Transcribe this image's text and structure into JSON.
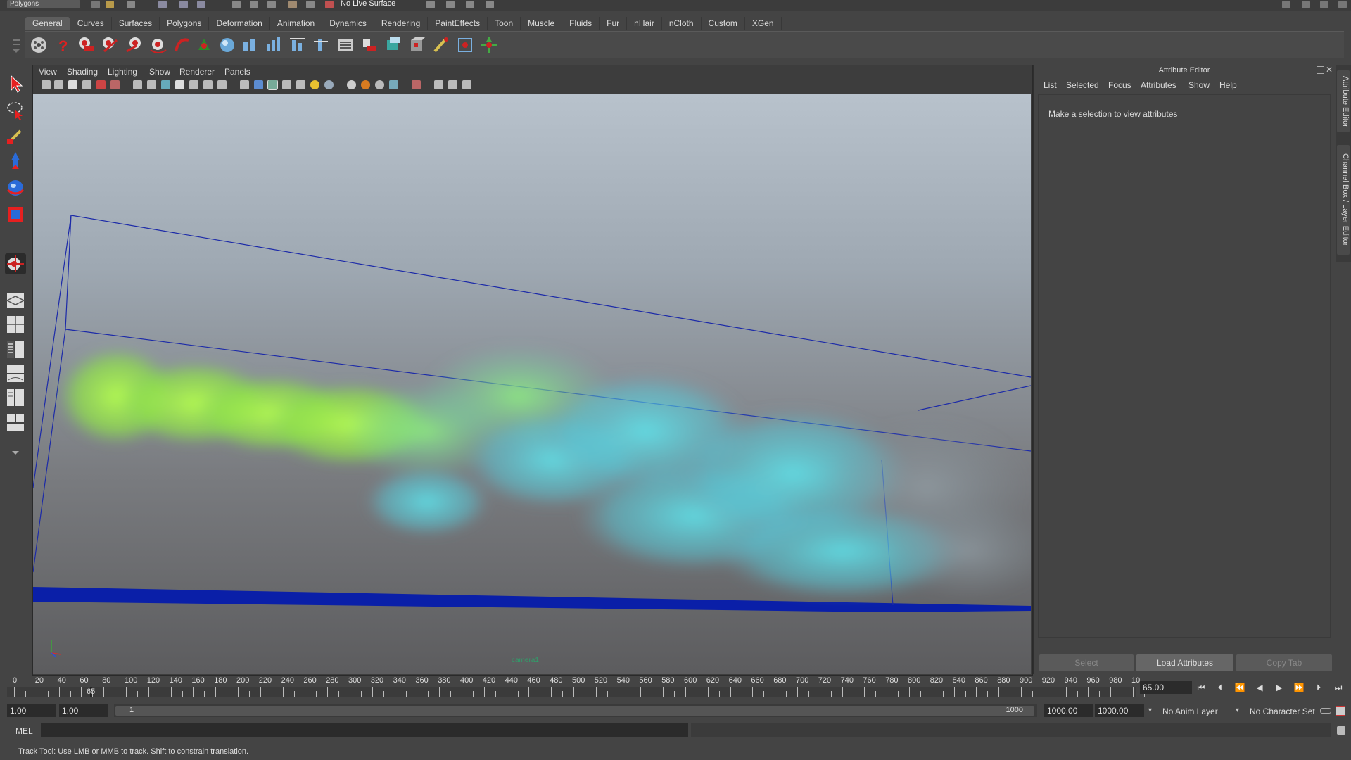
{
  "top_bar": {
    "mode": "Polygons",
    "live_surface": "No Live Surface"
  },
  "shelf": {
    "tabs": [
      "General",
      "Curves",
      "Surfaces",
      "Polygons",
      "Deformation",
      "Animation",
      "Dynamics",
      "Rendering",
      "PaintEffects",
      "Toon",
      "Muscle",
      "Fluids",
      "Fur",
      "nHair",
      "nCloth",
      "Custom",
      "XGen"
    ],
    "active_tab": "General"
  },
  "viewport": {
    "menu": [
      "View",
      "Shading",
      "Lighting",
      "Show",
      "Renderer",
      "Panels"
    ],
    "camera": "camera1"
  },
  "attribute_editor": {
    "title": "Attribute Editor",
    "menu": [
      "List",
      "Selected",
      "Focus",
      "Attributes",
      "Show",
      "Help"
    ],
    "message": "Make a selection to view attributes",
    "buttons": {
      "select": "Select",
      "load": "Load Attributes",
      "copy": "Copy Tab"
    }
  },
  "side_tabs": {
    "attribute_editor": "Attribute Editor",
    "channel_box": "Channel Box / Layer Editor"
  },
  "time_slider": {
    "ticks": [
      "0",
      "20",
      "40",
      "60",
      "80",
      "100",
      "120",
      "140",
      "160",
      "180",
      "200",
      "220",
      "240",
      "260",
      "280",
      "300",
      "320",
      "340",
      "360",
      "380",
      "400",
      "420",
      "440",
      "460",
      "480",
      "500",
      "520",
      "540",
      "560",
      "580",
      "600",
      "620",
      "640",
      "660",
      "680",
      "700",
      "720",
      "740",
      "760",
      "780",
      "800",
      "820",
      "840",
      "860",
      "880",
      "900",
      "920",
      "940",
      "960",
      "980",
      "10"
    ],
    "current_frame_marker": "65",
    "current_frame": "65.00"
  },
  "range_slider": {
    "start_time": "1.00",
    "playback_start": "1.00",
    "range_start": "1",
    "range_end": "1000",
    "playback_end": "1000.00",
    "end_time": "1000.00",
    "anim_layer": "No Anim Layer",
    "character_set": "No Character Set"
  },
  "command_line": {
    "label": "MEL"
  },
  "help_line": "Track Tool: Use LMB or MMB to track. Shift to constrain translation.",
  "colors": {
    "accent_blue": "#0a1fa8",
    "fluid_green": "#9ef04a",
    "fluid_cyan": "#4fd8e8"
  }
}
